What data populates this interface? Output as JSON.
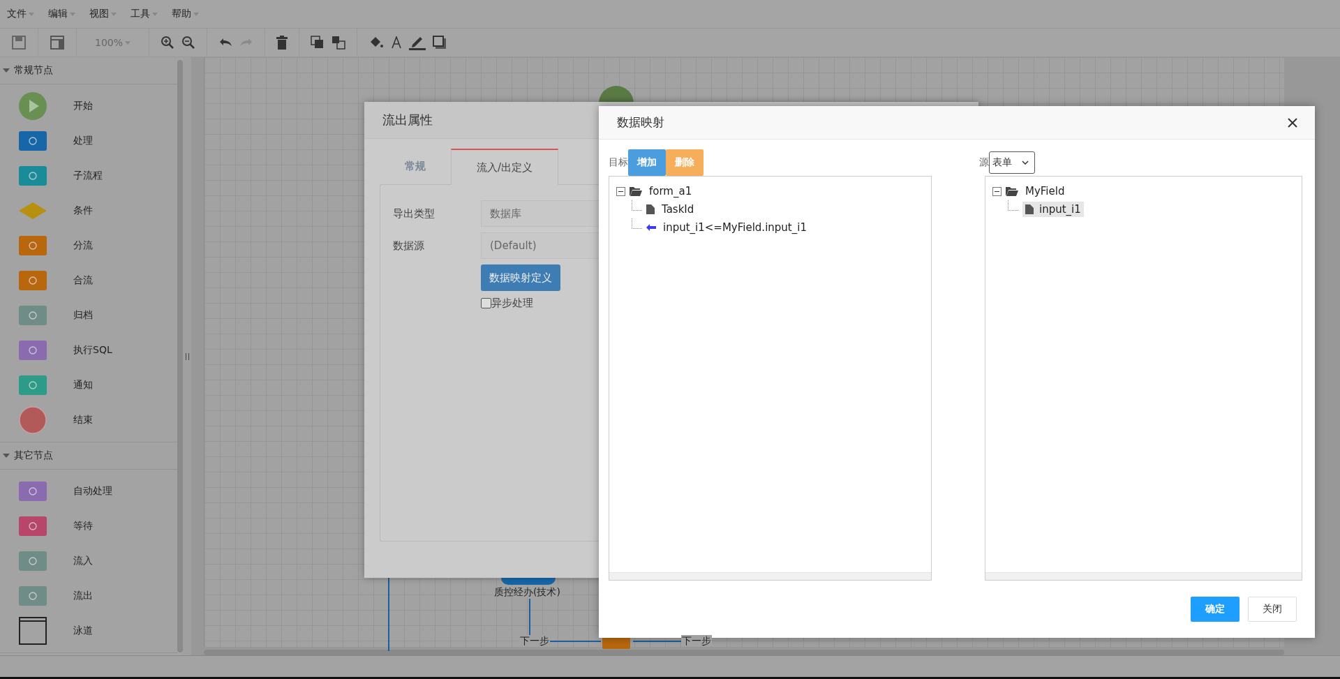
{
  "menu": [
    "文件",
    "编辑",
    "视图",
    "工具",
    "帮助"
  ],
  "toolbar": {
    "zoom": "100%"
  },
  "sidebar": {
    "sections": [
      {
        "title": "常规节点",
        "expanded": true,
        "items": [
          {
            "label": "开始",
            "kind": "start",
            "color": "#6a8f52"
          },
          {
            "label": "处理",
            "kind": "task",
            "color": "#1767a8"
          },
          {
            "label": "子流程",
            "kind": "subflow",
            "color": "#1a8c99"
          },
          {
            "label": "条件",
            "kind": "condition",
            "color": "#b8900f"
          },
          {
            "label": "分流",
            "kind": "split",
            "color": "#b8670d"
          },
          {
            "label": "合流",
            "kind": "merge",
            "color": "#b8670d"
          },
          {
            "label": "归档",
            "kind": "archive",
            "color": "#6f8c86"
          },
          {
            "label": "执行SQL",
            "kind": "sql",
            "color": "#8b6bb0"
          },
          {
            "label": "通知",
            "kind": "notify",
            "color": "#2c9b88"
          },
          {
            "label": "结束",
            "kind": "end",
            "color": "#b25a5a"
          }
        ]
      },
      {
        "title": "其它节点",
        "expanded": true,
        "items": [
          {
            "label": "自动处理",
            "kind": "auto",
            "color": "#8b6bb0"
          },
          {
            "label": "等待",
            "kind": "wait",
            "color": "#b7466a"
          },
          {
            "label": "流入",
            "kind": "inflow",
            "color": "#6f8c86"
          },
          {
            "label": "流出",
            "kind": "outflow",
            "color": "#6f8c86"
          },
          {
            "label": "泳道",
            "kind": "lane",
            "color": "#222222"
          }
        ]
      }
    ]
  },
  "canvas": {
    "labels": [
      {
        "text": "质控经办(技术)",
        "kind": "node"
      },
      {
        "text": "下一步",
        "kind": "edge"
      },
      {
        "text": "下一步",
        "kind": "edge"
      }
    ]
  },
  "props_dialog": {
    "title": "流出属性",
    "tabs": [
      {
        "label": "常规",
        "selected": false
      },
      {
        "label": "流入/出定义",
        "selected": true
      }
    ],
    "fields": [
      {
        "label": "导出类型",
        "value": "数据库"
      },
      {
        "label": "数据源",
        "value": "(Default)"
      }
    ],
    "button": "数据映射定义",
    "checkbox": {
      "label": "异步处理",
      "checked": false
    }
  },
  "mapping_dialog": {
    "title": "数据映射",
    "target_label": "目标",
    "add_button": "增加",
    "delete_button": "删除",
    "source_label": "源",
    "source_select": "表单",
    "target_tree": [
      {
        "label": "form_a1",
        "kind": "folder",
        "expanded": true,
        "selected": false,
        "children": [
          {
            "label": "TaskId",
            "kind": "file",
            "selected": false
          },
          {
            "label": "input_i1<=MyField.input_i1",
            "kind": "mapping",
            "selected": false
          }
        ]
      }
    ],
    "source_tree": [
      {
        "label": "MyField",
        "kind": "folder",
        "expanded": true,
        "selected": false,
        "children": [
          {
            "label": "input_i1",
            "kind": "file",
            "selected": true
          }
        ]
      }
    ],
    "ok_button": "确定",
    "close_button": "关闭"
  }
}
